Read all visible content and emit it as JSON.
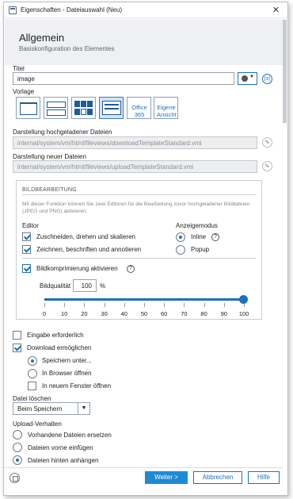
{
  "window": {
    "title": "Eigenschaften - Dateiauswahl (Neu)"
  },
  "header": {
    "title": "Allgemein",
    "subtitle": "Basiskonfiguration des Elementes"
  },
  "titel": {
    "label": "Titel",
    "value": "image"
  },
  "vorlage": {
    "label": "Vorlage",
    "office_label_1": "Office",
    "office_label_2": "365",
    "eigene_label_1": "Eigene",
    "eigene_label_2": "Ansicht"
  },
  "uploaded": {
    "label": "Darstellung hochgeladener Dateien",
    "value": "internal/system/vm/html/fileviews/downloadTemplateStandard.vmi"
  },
  "newfiles": {
    "label": "Darstellung neuer Dateien",
    "value": "internal/system/vm/html/fileviews/uploadTemplateStandard.vmi"
  },
  "bild": {
    "title": "BILDBEARBEITUNG",
    "desc": "Mit dieser Funktion können Sie zwei Editoren für die Bearbeitung zuvor hochgeladener Bilddateien (JPEG und PNG) aktivieren.",
    "editor_label": "Editor",
    "editor_1": "Zuschneiden, drehen und skalieren",
    "editor_2": "Zeichnen, beschriften und annotieren",
    "mode_label": "Anzeigemodus",
    "mode_inline": "Inline",
    "mode_popup": "Popup",
    "compress_label": "Bildkomprimierung aktivieren",
    "quality_label": "Bildqualität",
    "quality_value": "100",
    "quality_unit": "%",
    "quality_slider_percent": 100,
    "ticks": [
      "0",
      "10",
      "20",
      "30",
      "40",
      "50",
      "60",
      "70",
      "80",
      "90",
      "100"
    ]
  },
  "options": {
    "required": "Eingabe erforderlich",
    "download": "Download ermöglichen",
    "save_as": "Speichern unter...",
    "open_browser": "In Browser öffnen",
    "new_window": "In neuem Fenster öffnen"
  },
  "delete": {
    "label": "Datei löschen",
    "value": "Beim Speichern"
  },
  "upload": {
    "label": "Upload-Verhalten",
    "opt1": "Vorhandene Dateien ersetzen",
    "opt2": "Dateien vorne einfügen",
    "opt3": "Dateien hinten anhängen"
  },
  "buttons": {
    "next": "Weiter >",
    "cancel": "Abbrechen",
    "help": "Hilfe"
  },
  "colors": {
    "accent": "#1e6fc1",
    "primary_button": "#1e8ad6"
  }
}
